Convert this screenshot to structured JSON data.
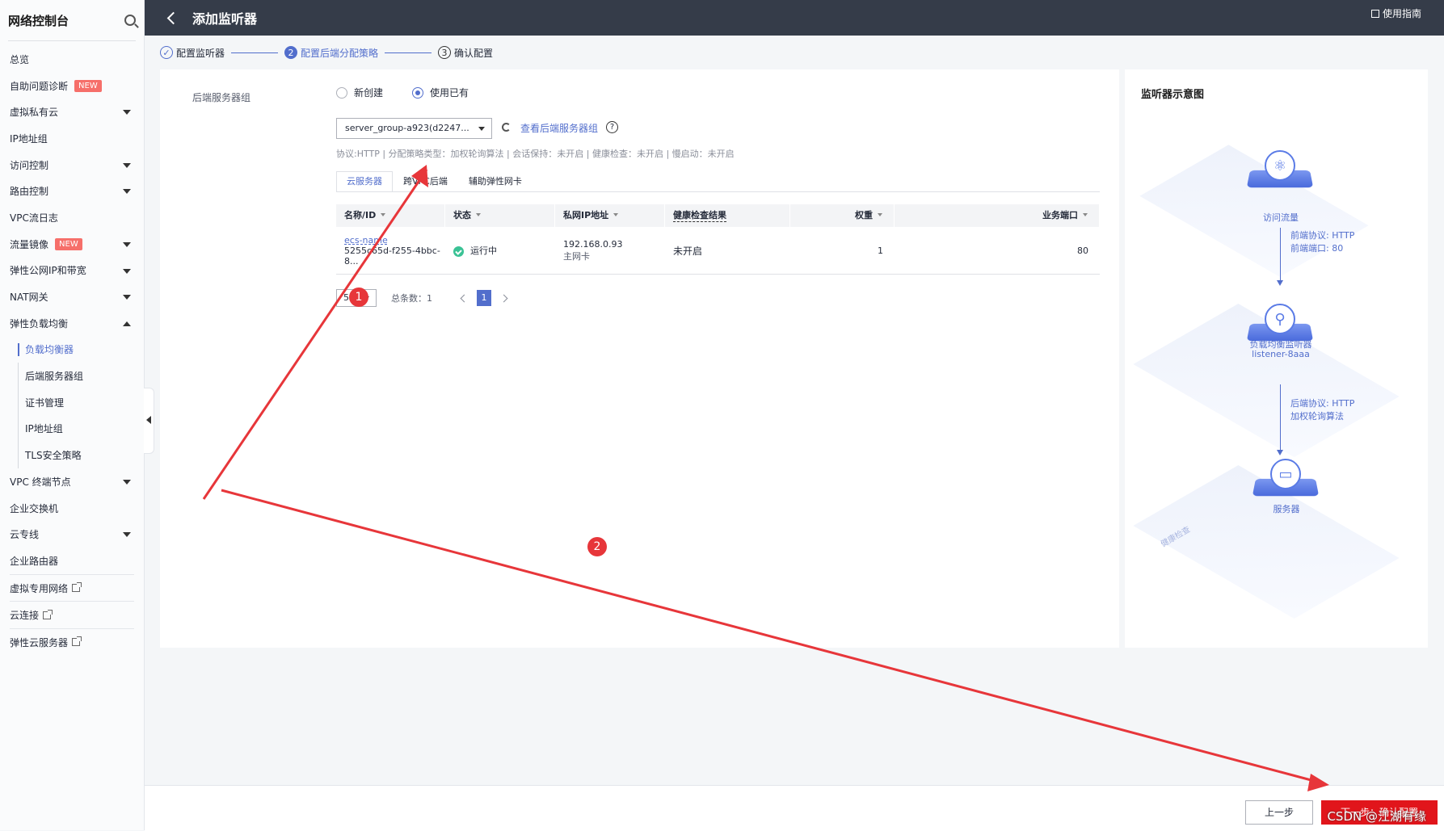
{
  "sidebar": {
    "title": "网络控制台",
    "items": [
      {
        "label": "总览"
      },
      {
        "label": "自助问题诊断",
        "badge": "NEW"
      },
      {
        "label": "虚拟私有云"
      },
      {
        "label": "IP地址组"
      },
      {
        "label": "访问控制"
      },
      {
        "label": "路由控制"
      },
      {
        "label": "VPC流日志"
      },
      {
        "label": "流量镜像",
        "badge": "NEW"
      },
      {
        "label": "弹性公网IP和带宽"
      },
      {
        "label": "NAT网关"
      },
      {
        "label": "弹性负载均衡"
      },
      {
        "label": "负载均衡器"
      },
      {
        "label": "后端服务器组"
      },
      {
        "label": "证书管理"
      },
      {
        "label": "IP地址组"
      },
      {
        "label": "TLS安全策略"
      },
      {
        "label": "VPC 终端节点"
      },
      {
        "label": "企业交换机"
      },
      {
        "label": "云专线"
      },
      {
        "label": "企业路由器"
      },
      {
        "label": "虚拟专用网络"
      },
      {
        "label": "云连接"
      },
      {
        "label": "弹性云服务器"
      }
    ]
  },
  "header": {
    "title": "添加监听器",
    "guide": "使用指南"
  },
  "steps": [
    {
      "num": "1",
      "label": "配置监听器"
    },
    {
      "num": "2",
      "label": "配置后端分配策略"
    },
    {
      "num": "3",
      "label": "确认配置"
    }
  ],
  "form": {
    "label": "后端服务器组",
    "radio_new": "新创建",
    "radio_existing": "使用已有",
    "select_value": "server_group-a923(d2247...",
    "view_link": "查看后端服务器组",
    "help": "?",
    "meta": "协议:HTTP | 分配策略类型：加权轮询算法 | 会话保持：未开启 | 健康检查：未开启 | 慢启动：未开启"
  },
  "tabs": [
    "云服务器",
    "跨VPC后端",
    "辅助弹性网卡"
  ],
  "table": {
    "headers": [
      "名称/ID",
      "状态",
      "私网IP地址",
      "健康检查结果",
      "权重",
      "业务端口"
    ],
    "rows": [
      {
        "name": "ecs-name",
        "id": "5255c65d-f255-4bbc-8...",
        "status": "运行中",
        "ip": "192.168.0.93",
        "nic": "主网卡",
        "health": "未开启",
        "weight": "1",
        "port": "80"
      }
    ]
  },
  "pager": {
    "size": "5",
    "total": "总条数：1",
    "current": "1"
  },
  "diagram": {
    "title": "监听器示意图",
    "node1": "访问流量",
    "proto1a": "前端协议: HTTP",
    "proto1b": "前端端口: 80",
    "node2": "负载均衡监听器",
    "node2_sub": "listener-8aaa",
    "proto2a": "后端协议: HTTP",
    "proto2b": "加权轮询算法",
    "health": "健康检查",
    "node3": "服务器"
  },
  "footer": {
    "prev": "上一步",
    "next": "下一步：确认配置",
    "watermark": "CSDN @江湖有缘"
  },
  "annotations": {
    "n1": "1",
    "n2": "2",
    "color": "#e7363a"
  },
  "colors": {
    "accent": "#526ecc",
    "topbar": "#353c49",
    "danger": "#e1151b",
    "status_ok": "#3ac295"
  }
}
